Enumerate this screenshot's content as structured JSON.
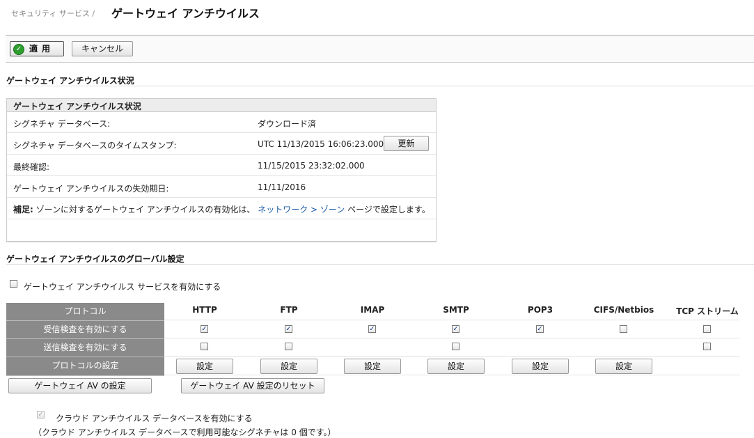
{
  "breadcrumb": {
    "parent": "セキュリティ サービス /",
    "title": "ゲートウェイ アンチウイルス"
  },
  "toolbar": {
    "apply_label": "適用",
    "cancel_label": "キャンセル"
  },
  "status_section": {
    "heading": "ゲートウェイ アンチウイルス状況",
    "panel_title": "ゲートウェイ アンチウイルス状況",
    "rows": {
      "db": {
        "label": "シグネチャ データベース:",
        "value": "ダウンロード済"
      },
      "timestamp": {
        "label": "シグネチャ データベースのタイムスタンプ:",
        "value": "UTC 11/13/2015 16:06:23.000",
        "button": "更新"
      },
      "last_check": {
        "label": "最終確認:",
        "value": "11/15/2015 23:32:02.000"
      },
      "expiry": {
        "label": "ゲートウェイ アンチウイルスの失効期日:",
        "value": "11/11/2016"
      }
    },
    "note": {
      "bold": "補足:",
      "text": "ゾーンに対するゲートウェイ アンチウイルスの有効化は、",
      "link": "ネットワーク > ゾーン",
      "suffix": "ページで設定します。"
    }
  },
  "global_section": {
    "heading": "ゲートウェイ アンチウイルスのグローバル設定",
    "enable_service": {
      "label": "ゲートウェイ アンチウイルス サービスを有効にする",
      "checked": false
    },
    "grid": {
      "row_labels": {
        "protocol": "プロトコル",
        "inbound": "受信検査を有効にする",
        "outbound": "送信検査を有効にする",
        "settings": "プロトコルの設定"
      },
      "columns": [
        "HTTP",
        "FTP",
        "IMAP",
        "SMTP",
        "POP3",
        "CIFS/Netbios",
        "TCP ストリーム"
      ],
      "inbound": [
        true,
        true,
        true,
        true,
        true,
        false,
        false
      ],
      "outbound": [
        false,
        false,
        null,
        false,
        null,
        null,
        false
      ],
      "config_button": "設定",
      "config_present": [
        true,
        true,
        true,
        true,
        true,
        true,
        false
      ]
    },
    "buttons": {
      "av_settings": "ゲートウェイ AV の設定",
      "av_reset": "ゲートウェイ AV 設定のリセット"
    },
    "cloud": {
      "label": "クラウド アンチウイルス データベースを有効にする",
      "checked": true,
      "note": "（クラウド アンチウイルス データベースで利用可能なシグネチャは 0 個です。）"
    }
  }
}
